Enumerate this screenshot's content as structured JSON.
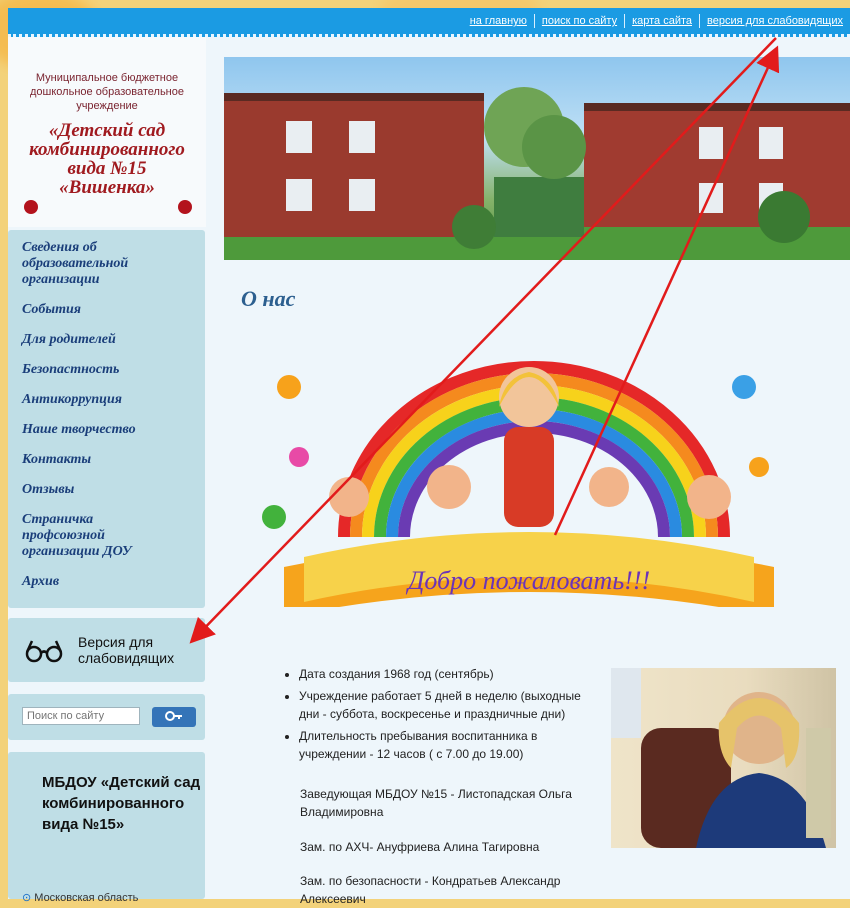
{
  "top_nav": {
    "links": [
      "на главную",
      "поиск по сайту",
      "карта сайта",
      "версия для слабовидящих"
    ]
  },
  "org": {
    "small_text": "Муниципальное бюджетное дошкольное образовательное учреждение",
    "name_lines": [
      "«Детский сад",
      "комбинированного",
      "вида №15",
      "«Вишенка»"
    ]
  },
  "sidebar_menu": {
    "items": [
      "Сведения об образовательной организации",
      "События",
      "Для родителей",
      "Безопастность",
      "Антикоррупция",
      "Наше творчество",
      "Контакты",
      "Отзывы",
      "Страничка профсоюзной организации ДОУ",
      "Архив"
    ]
  },
  "vision_version": {
    "label": "Версия для слабовидящих"
  },
  "search": {
    "placeholder": "Поиск по сайту"
  },
  "info_block": {
    "title": "МБДОУ «Детский сад комбинированного вида №15»",
    "address": "Московская область"
  },
  "main": {
    "title": "О нас",
    "banner_text": "Добро пожаловать!!!",
    "facts": [
      "Дата создания 1968 год (сентябрь)",
      "Учреждение работает 5 дней в неделю (выходные дни - суббота, воскресенье и праздничные дни)",
      "Длительность пребывания воспитанника в учреждении  -  12 часов ( с 7.00 до 19.00)"
    ],
    "staff": [
      "Заведующая  МБДОУ №15 - Листопадская Ольга Владимировна",
      " Зам. по АХЧ- Ануфриева Алина Тагировна",
      "Зам. по безопасности - Кондратьев Александр Алексеевич"
    ]
  },
  "colors": {
    "top_bar": "#1b9be3",
    "menu_bg": "#bfdee6",
    "menu_text": "#1a3e7a",
    "org_name": "#a01a1f",
    "title_blue": "#2c5f8f",
    "arrow_red": "#e21b1b"
  }
}
